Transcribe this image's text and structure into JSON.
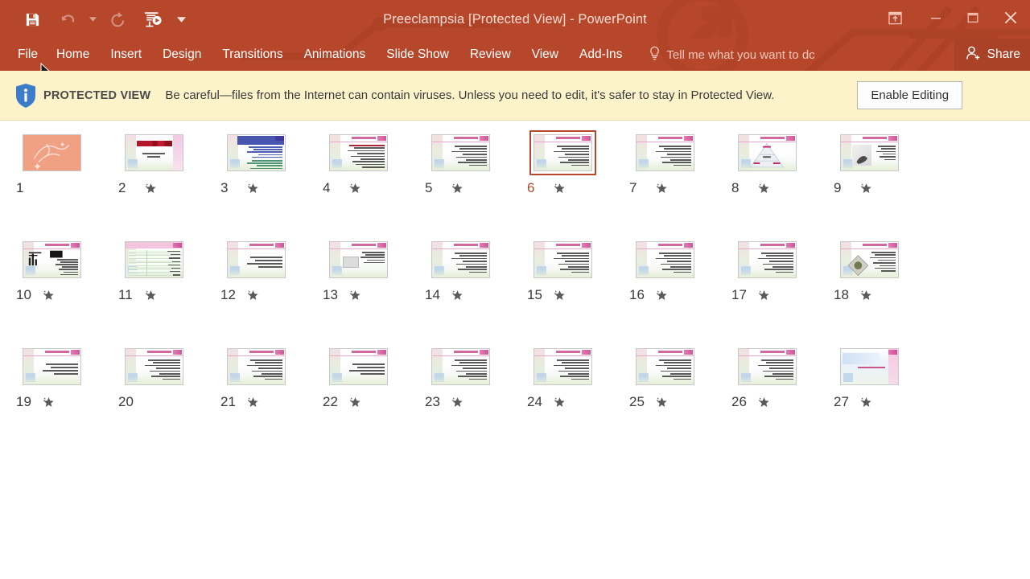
{
  "window": {
    "title": "Preeclampsia [Protected View] - PowerPoint",
    "accent_color": "#b7472a",
    "quick_access": [
      {
        "name": "save-icon",
        "label": "Save",
        "enabled": true
      },
      {
        "name": "undo-icon",
        "label": "Undo",
        "enabled": false
      },
      {
        "name": "redo-icon",
        "label": "Redo",
        "enabled": false
      },
      {
        "name": "start-presentation-icon",
        "label": "Start From Beginning",
        "enabled": true
      }
    ],
    "qat_overflow_label": "Customize Quick Access Toolbar",
    "controls": [
      {
        "name": "ribbon-display-options-icon",
        "label": "Ribbon Display Options"
      },
      {
        "name": "minimize-icon",
        "label": "Minimize"
      },
      {
        "name": "restore-icon",
        "label": "Restore Down"
      },
      {
        "name": "close-icon",
        "label": "Close"
      }
    ]
  },
  "ribbon": {
    "tabs": [
      {
        "label": "File"
      },
      {
        "label": "Home"
      },
      {
        "label": "Insert"
      },
      {
        "label": "Design"
      },
      {
        "label": "Transitions"
      },
      {
        "label": "Animations"
      },
      {
        "label": "Slide Show"
      },
      {
        "label": "Review"
      },
      {
        "label": "View"
      },
      {
        "label": "Add-Ins"
      }
    ],
    "tell_me": "Tell me what you want to dc",
    "tell_me_icon": "lightbulb-icon",
    "share_label": "Share",
    "share_icon": "person-add-icon"
  },
  "protected_view": {
    "icon": "shield-info-icon",
    "label": "PROTECTED VIEW",
    "message": "Be careful—files from the Internet can contain viruses. Unless you need to edit, it's safer to stay in Protected View.",
    "button_label": "Enable Editing",
    "background_color": "#fdf3ca"
  },
  "slide_sorter": {
    "selected_slide": 6,
    "columns": 9,
    "rows": 3,
    "slides": [
      {
        "number": "1",
        "starred": false,
        "kind": "title-cover"
      },
      {
        "number": "2",
        "starred": true,
        "kind": "roses-title"
      },
      {
        "number": "3",
        "starred": true,
        "kind": "dense-color-text"
      },
      {
        "number": "4",
        "starred": true,
        "kind": "bullets-red"
      },
      {
        "number": "5",
        "starred": true,
        "kind": "bullets"
      },
      {
        "number": "6",
        "starred": true,
        "kind": "bullets"
      },
      {
        "number": "7",
        "starred": true,
        "kind": "bullets"
      },
      {
        "number": "8",
        "starred": true,
        "kind": "pyramid"
      },
      {
        "number": "9",
        "starred": true,
        "kind": "photo"
      },
      {
        "number": "10",
        "starred": true,
        "kind": "chart-bullets"
      },
      {
        "number": "11",
        "starred": true,
        "kind": "table-green"
      },
      {
        "number": "12",
        "starred": true,
        "kind": "bullets-sparse"
      },
      {
        "number": "13",
        "starred": true,
        "kind": "photo-small"
      },
      {
        "number": "14",
        "starred": true,
        "kind": "bullets"
      },
      {
        "number": "15",
        "starred": true,
        "kind": "bullets"
      },
      {
        "number": "16",
        "starred": true,
        "kind": "bullets"
      },
      {
        "number": "17",
        "starred": true,
        "kind": "bullets"
      },
      {
        "number": "18",
        "starred": true,
        "kind": "diamond-photo"
      },
      {
        "number": "19",
        "starred": true,
        "kind": "bullets-sparse"
      },
      {
        "number": "20",
        "starred": false,
        "kind": "bullets"
      },
      {
        "number": "21",
        "starred": true,
        "kind": "bullets"
      },
      {
        "number": "22",
        "starred": true,
        "kind": "bullets-sparse"
      },
      {
        "number": "23",
        "starred": true,
        "kind": "bullets"
      },
      {
        "number": "24",
        "starred": true,
        "kind": "bullets"
      },
      {
        "number": "25",
        "starred": true,
        "kind": "bullets"
      },
      {
        "number": "26",
        "starred": true,
        "kind": "bullets"
      },
      {
        "number": "27",
        "starred": true,
        "kind": "closing"
      }
    ],
    "star_icon": "star-animation-icon"
  }
}
